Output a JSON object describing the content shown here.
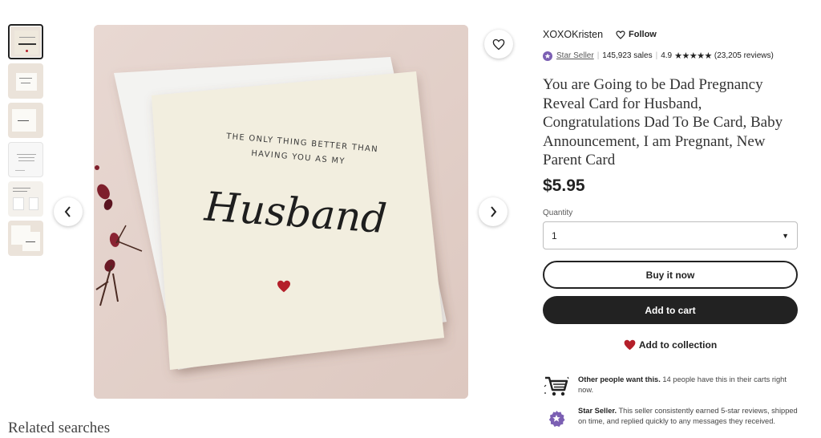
{
  "product": {
    "shop_name": "XOXOKristen",
    "follow_label": "Follow",
    "star_seller_label": "Star Seller",
    "sales": "145,923 sales",
    "rating": "4.9",
    "stars": "★★★★★",
    "reviews": "(23,205 reviews)",
    "title": "You are Going to be Dad Pregnancy Reveal Card for Husband, Congratulations Dad To Be Card, Baby Announcement, I am Pregnant, New Parent Card",
    "price": "$5.95",
    "quantity_label": "Quantity",
    "quantity_value": "1",
    "buy_now_label": "Buy it now",
    "add_to_cart_label": "Add to cart",
    "add_to_collection_label": "Add to collection"
  },
  "image": {
    "card_line1": "THE ONLY THING BETTER THAN",
    "card_line2": "HAVING YOU AS MY",
    "card_script": "Husband"
  },
  "highlights": [
    {
      "icon": "cart-icon",
      "bold": "Other people want this.",
      "text": " 14 people have this in their carts right now."
    },
    {
      "icon": "star-seller-badge-icon",
      "bold": "Star Seller.",
      "text": " This seller consistently earned 5-star reviews, shipped on time, and replied quickly to any messages they received."
    }
  ],
  "related_searches_label": "Related searches",
  "colors": {
    "accent_dark": "#222222",
    "heart_red": "#b41f2a",
    "star_seller_purple": "#7b5fb3"
  }
}
